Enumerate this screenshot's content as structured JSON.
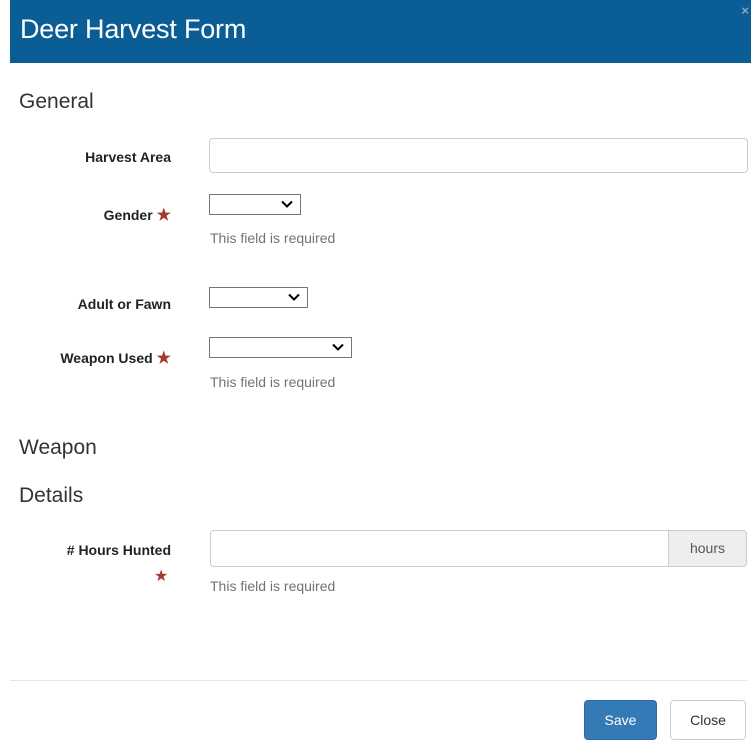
{
  "modal": {
    "title": "Deer Harvest Form",
    "close_glyph": "×"
  },
  "sections": {
    "general": "General",
    "weapon": "Weapon",
    "details": "Details"
  },
  "fields": {
    "harvest_area": {
      "label": "Harvest Area",
      "value": "",
      "placeholder": ""
    },
    "gender": {
      "label": "Gender",
      "selected": "",
      "required_star": "★",
      "help": "This field is required"
    },
    "adult_or_fawn": {
      "label": "Adult or Fawn",
      "selected": ""
    },
    "weapon_used": {
      "label": "Weapon Used",
      "selected": "",
      "required_star": "★",
      "help": "This field is required"
    },
    "hours_hunted": {
      "label": "# Hours Hunted",
      "value": "",
      "addon": "hours",
      "required_star": "★",
      "help": "This field is required"
    }
  },
  "footer": {
    "save_label": "Save",
    "close_label": "Close"
  },
  "colors": {
    "header_bg": "#0b5e95",
    "primary_button": "#337ab7",
    "required_star": "#a33a2c"
  }
}
